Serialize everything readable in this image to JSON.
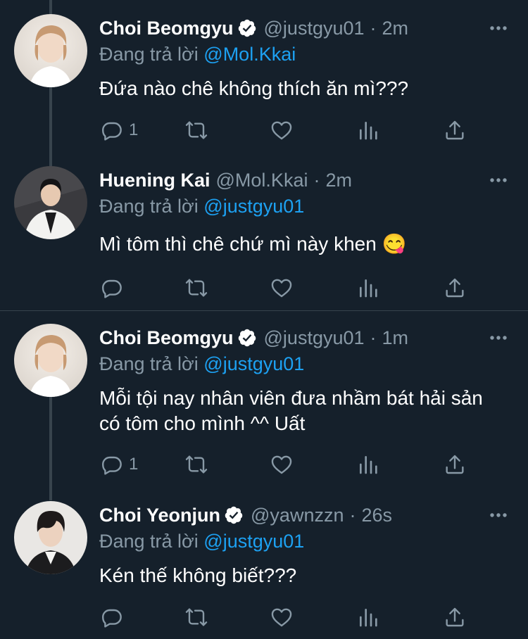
{
  "tweets": [
    {
      "name": "Choi Beomgyu",
      "verified": true,
      "handle": "@justgyu01",
      "time": "2m",
      "reply_label": "Đang trả lời",
      "reply_to": "@Mol.Kkai",
      "text": "Đứa nào chê không thích ăn mì???",
      "reply_count": "1"
    },
    {
      "name": "Huening Kai",
      "verified": false,
      "handle": "@Mol.Kkai",
      "time": "2m",
      "reply_label": "Đang trả lời",
      "reply_to": "@justgyu01",
      "text": "Mì tôm thì chê chứ mì này khen 😋",
      "reply_count": ""
    },
    {
      "name": "Choi Beomgyu",
      "verified": true,
      "handle": "@justgyu01",
      "time": "1m",
      "reply_label": "Đang trả lời",
      "reply_to": "@justgyu01",
      "text": "Mỗi tội nay nhân viên đưa nhầm bát hải sản có tôm cho mình ^^ Uất",
      "reply_count": "1"
    },
    {
      "name": "Choi Yeonjun",
      "verified": true,
      "handle": "@yawnzzn",
      "time": "26s",
      "reply_label": "Đang trả lời",
      "reply_to": "@justgyu01",
      "text": "Kén thế không biết???",
      "reply_count": ""
    }
  ],
  "separator": "·",
  "colors": {
    "background": "#15202b",
    "muted": "#8899a6",
    "link": "#1da1f2",
    "verified_badge": "#ffffff",
    "thread_line": "#38444d"
  },
  "icons": [
    "reply-icon",
    "retweet-icon",
    "like-icon",
    "analytics-icon",
    "share-icon",
    "more-icon",
    "verified-icon"
  ]
}
